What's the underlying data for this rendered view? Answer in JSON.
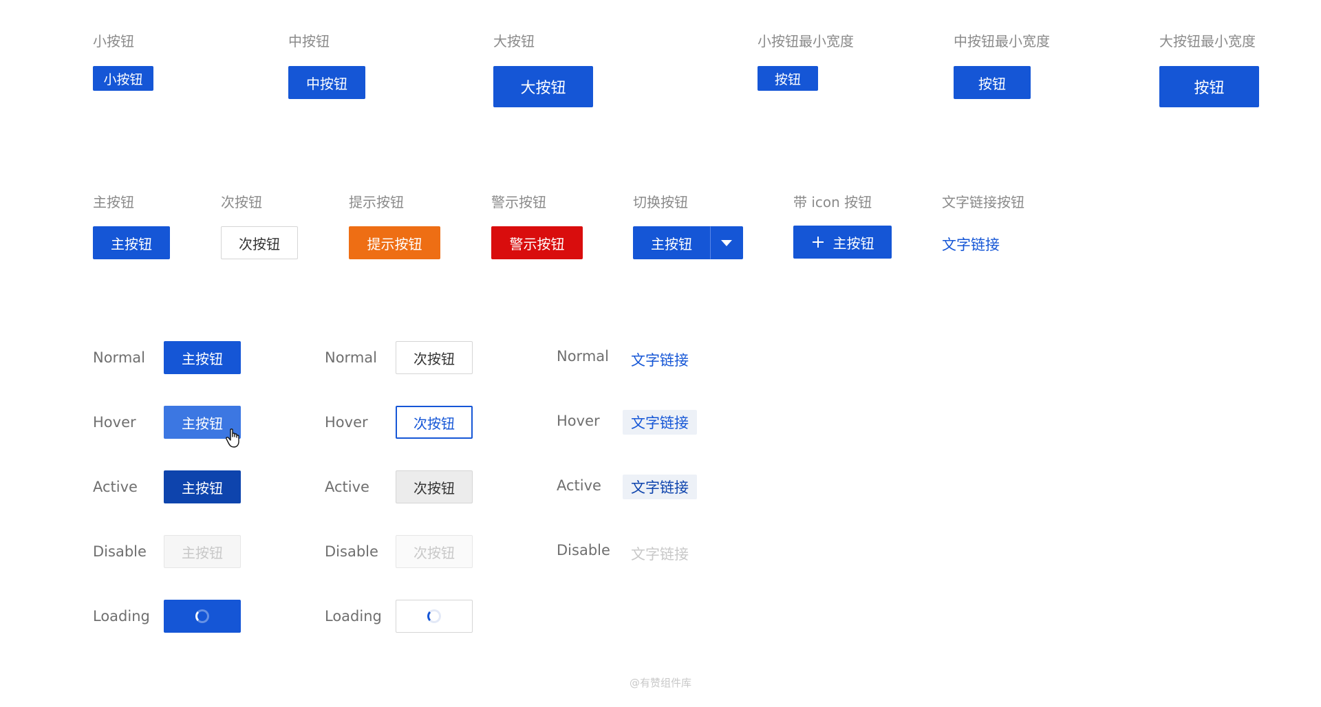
{
  "sizes": {
    "small_label": "小按钮",
    "small_button": "小按钮",
    "medium_label": "中按钮",
    "medium_button": "中按钮",
    "large_label": "大按钮",
    "large_button": "大按钮",
    "small_min_label": "小按钮最小宽度",
    "medium_min_label": "中按钮最小宽度",
    "large_min_label": "大按钮最小宽度",
    "min_button": "按钮"
  },
  "types": {
    "primary_label": "主按钮",
    "primary_button": "主按钮",
    "secondary_label": "次按钮",
    "secondary_button": "次按钮",
    "hint_label": "提示按钮",
    "hint_button": "提示按钮",
    "warn_label": "警示按钮",
    "warn_button": "警示按钮",
    "toggle_label": "切换按钮",
    "toggle_button": "主按钮",
    "icon_label": "带 icon 按钮",
    "icon_button": "主按钮",
    "text_link_label": "文字链接按钮",
    "text_link": "文字链接"
  },
  "states": {
    "normal": "Normal",
    "hover": "Hover",
    "active": "Active",
    "disable": "Disable",
    "loading": "Loading",
    "primary_text": "主按钮",
    "secondary_text": "次按钮",
    "link_text": "文字链接"
  },
  "colors": {
    "primary": "#1556d6",
    "primary_hover": "#3c77e2",
    "primary_active": "#0e44ad",
    "hint": "#ee6e14",
    "warn": "#d90d0d"
  },
  "icons": {
    "toggle": "caret-down-icon",
    "add": "plus-icon",
    "loading": "spinner-icon",
    "cursor": "hand-cursor-icon"
  },
  "footer": "@有赞组件库"
}
